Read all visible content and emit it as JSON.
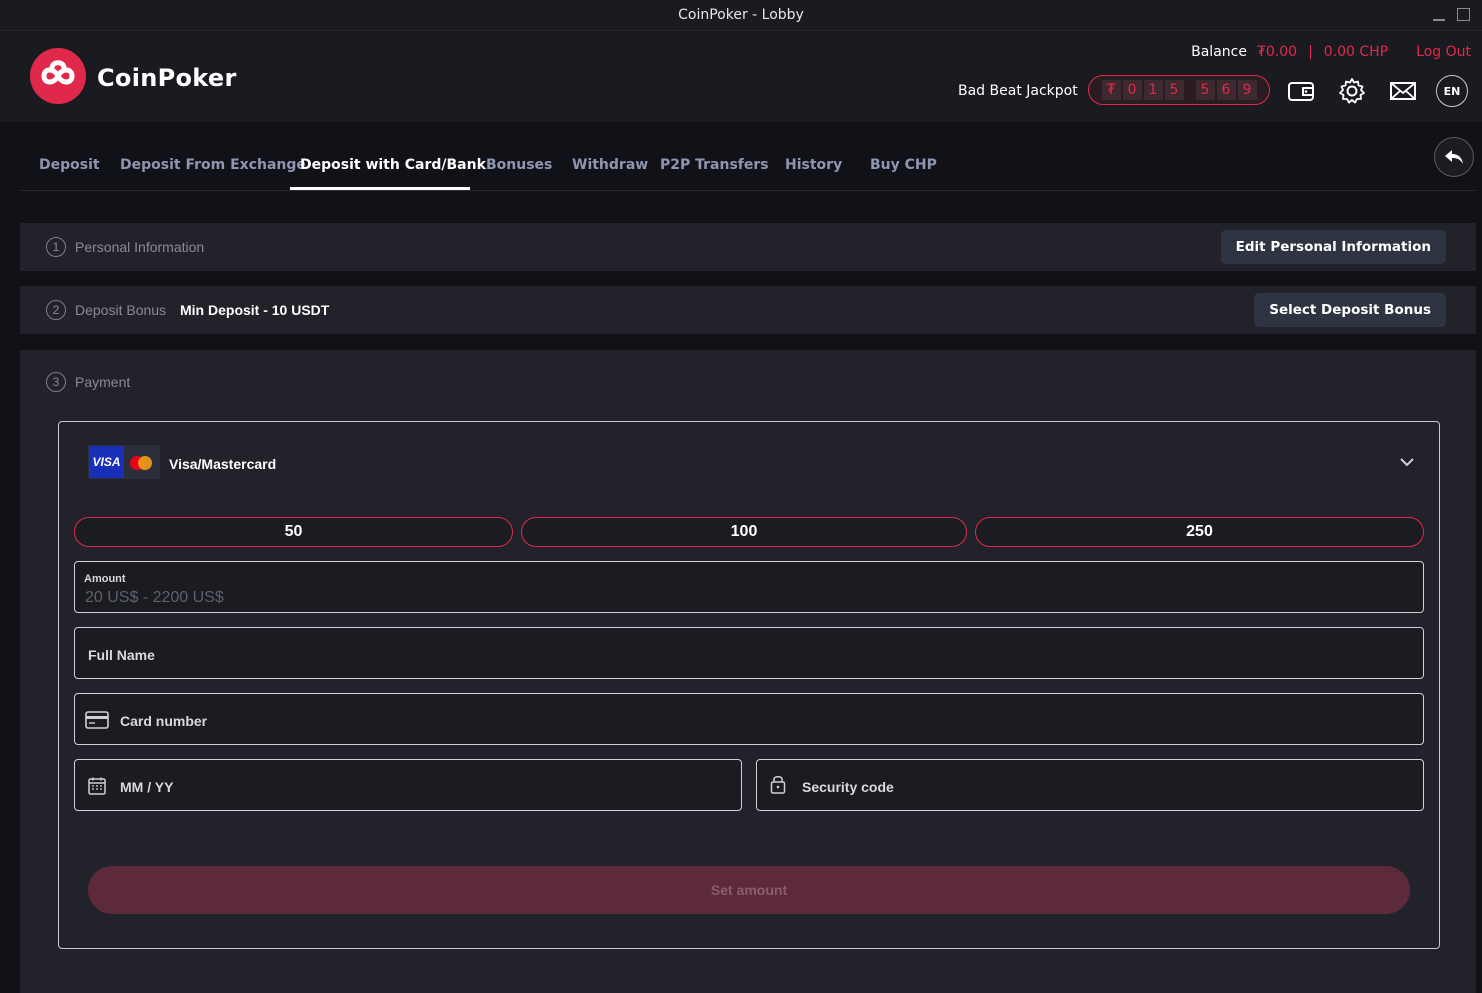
{
  "window": {
    "title": "CoinPoker - Lobby"
  },
  "brand": {
    "name": "CoinPoker",
    "accent": "#e0294a"
  },
  "header": {
    "balance_label": "Balance",
    "balance_chp_token": "₮0.00",
    "balance_separator": "|",
    "balance_chp": "0.00 CHP",
    "logout": "Log Out",
    "jackpot_label": "Bad Beat Jackpot",
    "jackpot_digits": [
      "₮",
      "0",
      "1",
      "5",
      "5",
      "6",
      "9"
    ],
    "icons": [
      "wallet-icon",
      "gear-icon",
      "mail-icon"
    ],
    "language": "EN"
  },
  "tabs": [
    {
      "label": "Deposit",
      "active": false
    },
    {
      "label": "Deposit From Exchange",
      "active": false
    },
    {
      "label": "Deposit with Card/Bank",
      "active": true
    },
    {
      "label": "Bonuses",
      "active": false
    },
    {
      "label": "Withdraw",
      "active": false
    },
    {
      "label": "P2P Transfers",
      "active": false
    },
    {
      "label": "History",
      "active": false
    },
    {
      "label": "Buy CHP",
      "active": false
    }
  ],
  "steps": {
    "personal": {
      "number": "1",
      "title": "Personal Information",
      "button": "Edit Personal Information"
    },
    "bonus": {
      "number": "2",
      "title": "Deposit Bonus",
      "subtitle": "Min Deposit - 10 USDT",
      "button": "Select Deposit Bonus"
    },
    "payment": {
      "number": "3",
      "title": "Payment"
    }
  },
  "payment": {
    "method_badge_text": "VISA",
    "method_label": "Visa/Mastercard",
    "presets": [
      "50",
      "100",
      "250"
    ],
    "amount_label": "Amount",
    "amount_placeholder": "20 US$ - 2200 US$",
    "full_name": "Full Name",
    "card_number": "Card number",
    "expiry": "MM / YY",
    "security_code": "Security code",
    "submit": "Set amount"
  }
}
